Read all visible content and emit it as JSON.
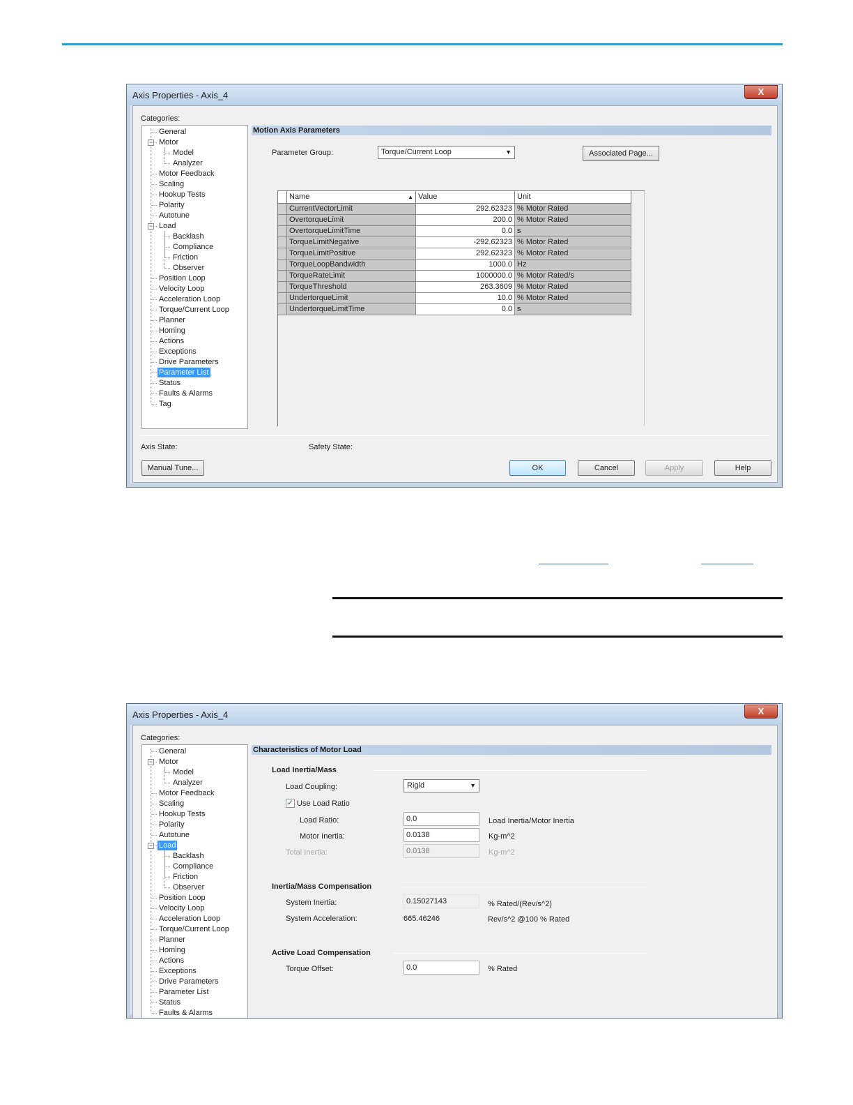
{
  "window1": {
    "title": "Axis Properties - Axis_4",
    "close_label": "X",
    "categories_label": "Categories:",
    "tree": [
      "General",
      "Motor",
      "Model",
      "Analyzer",
      "Motor Feedback",
      "Scaling",
      "Hookup Tests",
      "Polarity",
      "Autotune",
      "Load",
      "Backlash",
      "Compliance",
      "Friction",
      "Observer",
      "Position Loop",
      "Velocity Loop",
      "Acceleration Loop",
      "Torque/Current Loop",
      "Planner",
      "Homing",
      "Actions",
      "Exceptions",
      "Drive Parameters",
      "Parameter List",
      "Status",
      "Faults & Alarms",
      "Tag"
    ],
    "selected": "Parameter List",
    "section_title": "Motion Axis Parameters",
    "param_group_label": "Parameter Group:",
    "param_group_value": "Torque/Current Loop",
    "associated_page": "Associated Page...",
    "columns": {
      "name": "Name",
      "value": "Value",
      "unit": "Unit"
    },
    "rows": [
      {
        "name": "CurrentVectorLimit",
        "value": "292.62323",
        "unit": "% Motor Rated"
      },
      {
        "name": "OvertorqueLimit",
        "value": "200.0",
        "unit": "% Motor Rated"
      },
      {
        "name": "OvertorqueLimitTime",
        "value": "0.0",
        "unit": "s"
      },
      {
        "name": "TorqueLimitNegative",
        "value": "-292.62323",
        "unit": "% Motor Rated"
      },
      {
        "name": "TorqueLimitPositive",
        "value": "292.62323",
        "unit": "% Motor Rated"
      },
      {
        "name": "TorqueLoopBandwidth",
        "value": "1000.0",
        "unit": "Hz"
      },
      {
        "name": "TorqueRateLimit",
        "value": "1000000.0",
        "unit": "% Motor Rated/s"
      },
      {
        "name": "TorqueThreshold",
        "value": "263.3609",
        "unit": "% Motor Rated"
      },
      {
        "name": "UndertorqueLimit",
        "value": "10.0",
        "unit": "% Motor Rated"
      },
      {
        "name": "UndertorqueLimitTime",
        "value": "0.0",
        "unit": "s"
      }
    ],
    "axis_state_label": "Axis State:",
    "safety_state_label": "Safety State:",
    "buttons": {
      "manual_tune": "Manual Tune...",
      "ok": "OK",
      "cancel": "Cancel",
      "apply": "Apply",
      "help": "Help"
    }
  },
  "window2": {
    "title": "Axis Properties - Axis_4",
    "close_label": "X",
    "categories_label": "Categories:",
    "tree": [
      "General",
      "Motor",
      "Model",
      "Analyzer",
      "Motor Feedback",
      "Scaling",
      "Hookup Tests",
      "Polarity",
      "Autotune",
      "Load",
      "Backlash",
      "Compliance",
      "Friction",
      "Observer",
      "Position Loop",
      "Velocity Loop",
      "Acceleration Loop",
      "Torque/Current Loop",
      "Planner",
      "Homing",
      "Actions",
      "Exceptions",
      "Drive Parameters",
      "Parameter List",
      "Status",
      "Faults & Alarms"
    ],
    "selected": "Load",
    "section_title": "Characteristics of Motor Load",
    "group1": "Load Inertia/Mass",
    "load_coupling_label": "Load Coupling:",
    "load_coupling_value": "Rigid",
    "use_load_ratio_label": "Use Load Ratio",
    "use_load_ratio_checked": true,
    "load_ratio_label": "Load Ratio:",
    "load_ratio_value": "0.0",
    "load_ratio_unit": "Load Inertia/Motor Inertia",
    "motor_inertia_label": "Motor Inertia:",
    "motor_inertia_value": "0.0138",
    "motor_inertia_unit": "Kg-m^2",
    "total_inertia_label": "Total Inertia:",
    "total_inertia_value": "0.0138",
    "total_inertia_unit": "Kg-m^2",
    "group2": "Inertia/Mass Compensation",
    "system_inertia_label": "System Inertia:",
    "system_inertia_value": "0.15027143",
    "system_inertia_unit": "% Rated/(Rev/s^2)",
    "system_accel_label": "System Acceleration:",
    "system_accel_value": "665.46246",
    "system_accel_unit": "Rev/s^2 @100 % Rated",
    "group3": "Active Load Compensation",
    "torque_offset_label": "Torque Offset:",
    "torque_offset_value": "0.0",
    "torque_offset_unit": "% Rated"
  }
}
